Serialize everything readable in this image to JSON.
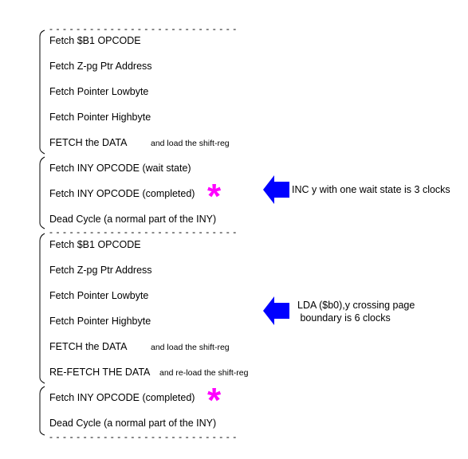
{
  "separator": "- - - - - - - - - - - - - - - - - - - - - - - - - - - -",
  "groups": [
    {
      "rows": [
        {
          "text": "Fetch $B1 OPCODE"
        },
        {
          "text": "Fetch Z-pg Ptr Address"
        },
        {
          "text": "Fetch Pointer Lowbyte"
        },
        {
          "text": "Fetch Pointer Highbyte"
        },
        {
          "text": "FETCH the DATA",
          "note": "and  load the shift-reg"
        }
      ]
    },
    {
      "rows": [
        {
          "text": "Fetch  INY OPCODE (wait state)"
        },
        {
          "text": "Fetch  INY OPCODE (completed)",
          "star": true
        },
        {
          "text": "Dead Cycle (a normal part of the INY)"
        }
      ]
    },
    {
      "rows": [
        {
          "text": "Fetch $B1 OPCODE"
        },
        {
          "text": "Fetch Z-pg Ptr Address"
        },
        {
          "text": "Fetch Pointer Lowbyte"
        },
        {
          "text": "Fetch Pointer Highbyte"
        },
        {
          "text": "FETCH the DATA",
          "note": "and  load the shift-reg"
        },
        {
          "text": "RE-FETCH THE DATA",
          "note": "and  re-load the shift-reg"
        }
      ]
    },
    {
      "rows": [
        {
          "text": "Fetch  INY OPCODE (completed)",
          "star": true
        },
        {
          "text": "Dead Cycle (a normal part of the INY)"
        }
      ]
    }
  ],
  "annotations": [
    {
      "text": "INC y with one wait state is 3 clocks",
      "icon": "left-arrow-icon"
    },
    {
      "text": "LDA ($b0),y crossing page\n boundary is 6 clocks",
      "icon": "left-arrow-icon"
    }
  ],
  "colors": {
    "arrow": "#0000ff",
    "star": "#ff00ff"
  }
}
